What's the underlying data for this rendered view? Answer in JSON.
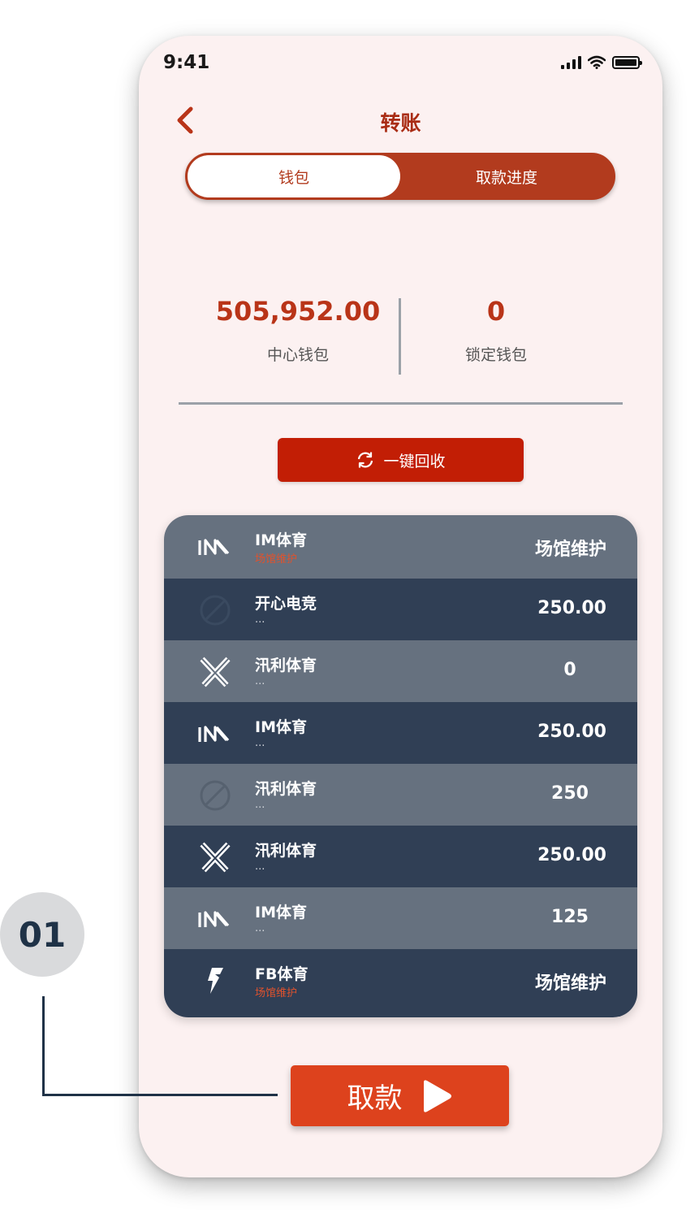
{
  "status_bar": {
    "time": "9:41"
  },
  "nav": {
    "title": "转账"
  },
  "tabs": [
    {
      "label": "钱包",
      "active": true
    },
    {
      "label": "取款进度",
      "active": false
    }
  ],
  "balances": {
    "center": {
      "value": "505,952.00",
      "label": "中心钱包"
    },
    "locked": {
      "value": "0",
      "label": "锁定钱包"
    }
  },
  "recycle_button": {
    "label": "一键回收",
    "icon": "refresh-icon"
  },
  "platforms": [
    {
      "name": "IM体育",
      "sub": "场馆维护",
      "value": "场馆维护",
      "icon": "im-logo-icon",
      "maintenance": true
    },
    {
      "name": "开心电竞",
      "sub": "...",
      "value": "250.00",
      "icon": "disabled-circle-icon",
      "maintenance": false
    },
    {
      "name": "汛利体育",
      "sub": "...",
      "value": "0",
      "icon": "x-logo-icon",
      "maintenance": false
    },
    {
      "name": "IM体育",
      "sub": "...",
      "value": "250.00",
      "icon": "im-logo-icon",
      "maintenance": false
    },
    {
      "name": "汛利体育",
      "sub": "...",
      "value": "250",
      "icon": "disabled-circle-icon",
      "maintenance": false
    },
    {
      "name": "汛利体育",
      "sub": "...",
      "value": "250.00",
      "icon": "x-logo-icon",
      "maintenance": false
    },
    {
      "name": "IM体育",
      "sub": "...",
      "value": "125",
      "icon": "im-logo-icon",
      "maintenance": false
    },
    {
      "name": "FB体育",
      "sub": "场馆维护",
      "value": "场馆维护",
      "icon": "fb-logo-icon",
      "maintenance": true
    }
  ],
  "withdraw_button": {
    "label": "取款",
    "icon": "play-arrow-icon"
  },
  "annotation": {
    "step": "01"
  },
  "colors": {
    "primary": "#b23b1e",
    "button_red": "#c21e05",
    "withdraw": "#dd421d",
    "row_light": "#66717f",
    "row_dark": "#303f55",
    "background": "#fcf1f1"
  }
}
